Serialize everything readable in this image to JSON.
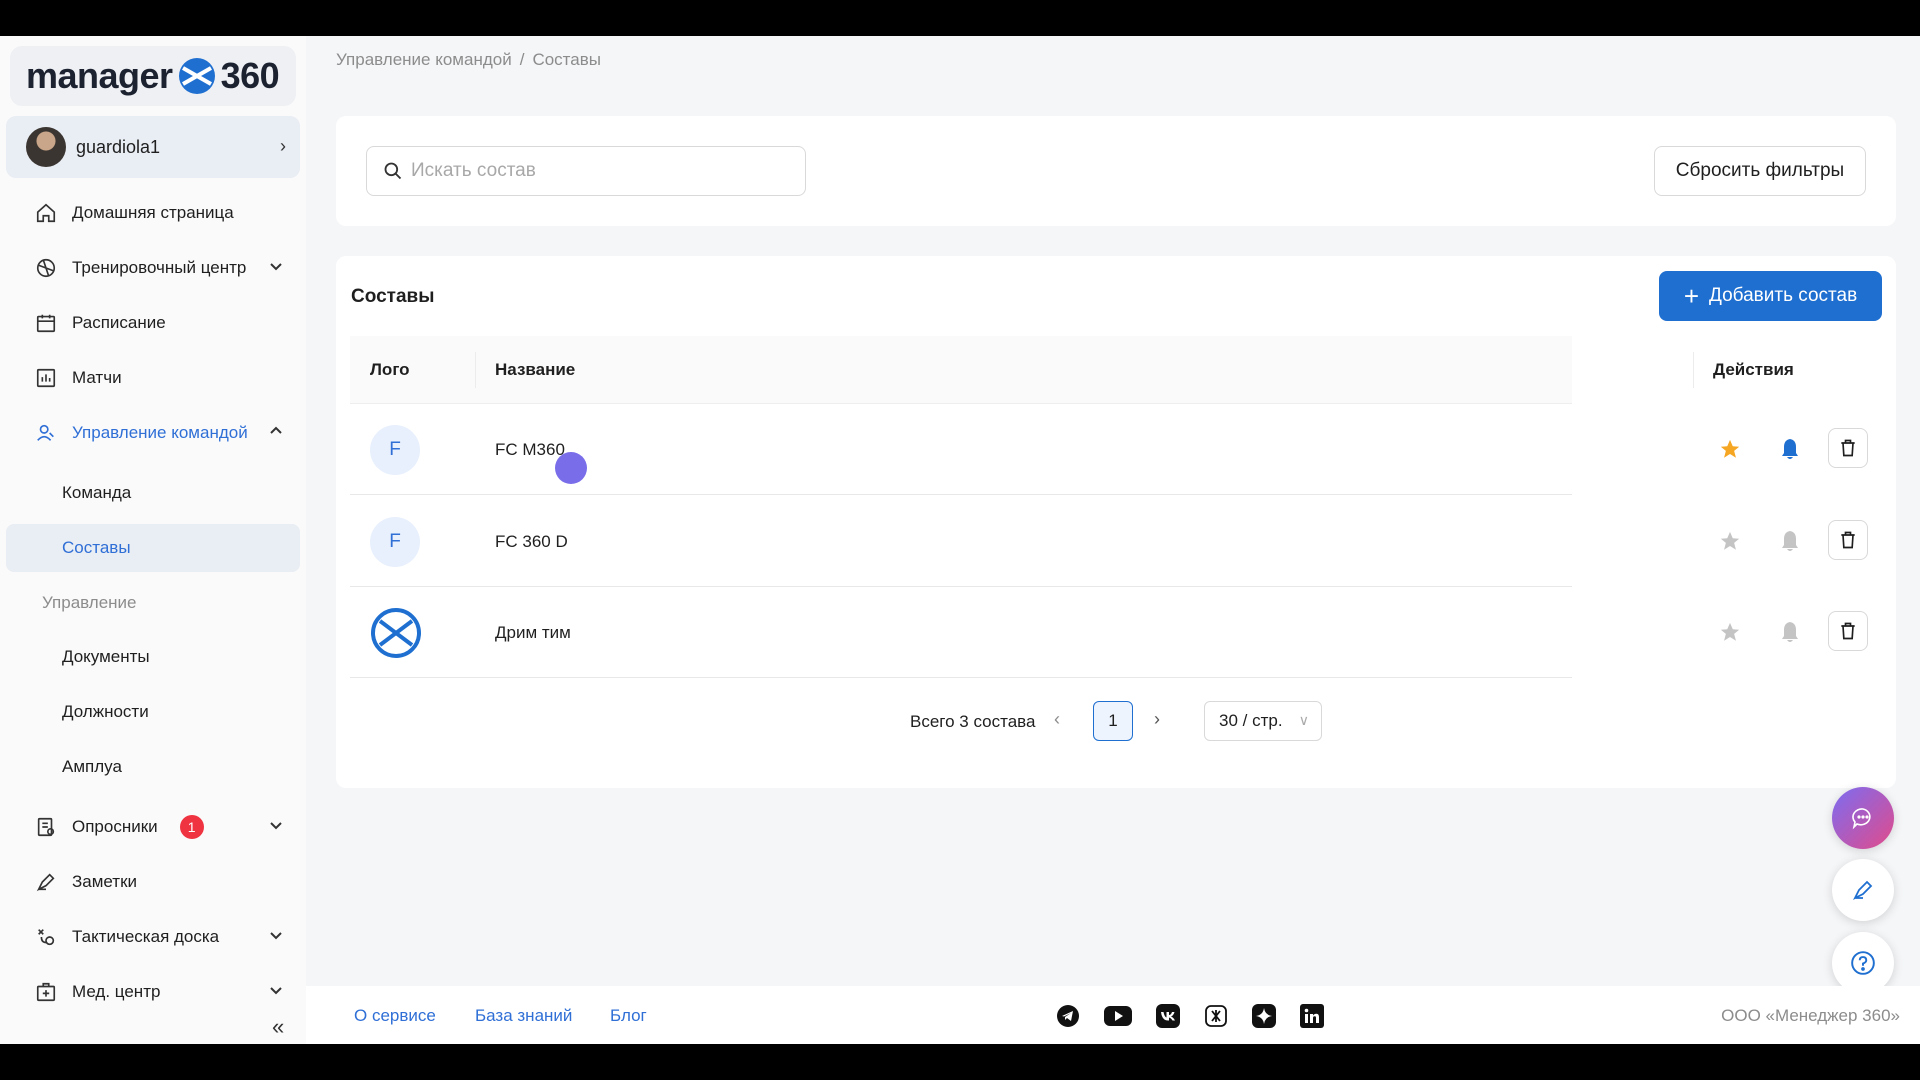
{
  "brand": {
    "name_left": "manager",
    "name_right": "360"
  },
  "user": {
    "name": "guardiola1"
  },
  "nav": {
    "home": "Домашняя страница",
    "training": "Тренировочный центр",
    "schedule": "Расписание",
    "matches": "Матчи",
    "team_mgmt": "Управление командой",
    "team": "Команда",
    "rosters": "Составы",
    "group_mgmt": "Управление",
    "documents": "Документы",
    "positions": "Должности",
    "roles": "Амплуа",
    "surveys": "Опросники",
    "surveys_badge": "1",
    "notes": "Заметки",
    "tactics": "Тактическая доска",
    "medical": "Мед. центр"
  },
  "breadcrumb": {
    "parent": "Управление командой",
    "sep": "/",
    "current": "Составы"
  },
  "search": {
    "placeholder": "Искать состав",
    "value": ""
  },
  "reset_filters": "Сбросить фильтры",
  "rosters_card": {
    "title": "Составы",
    "add_button": "Добавить состав"
  },
  "table": {
    "columns": {
      "logo": "Лого",
      "name": "Название",
      "actions": "Действия"
    },
    "rows": [
      {
        "logo_letter": "F",
        "name": "FC M360",
        "favorite": true,
        "notifications": true
      },
      {
        "logo_letter": "F",
        "name": "FC 360 D",
        "favorite": false,
        "notifications": false
      },
      {
        "logo_letter": "",
        "name": "Дрим тим",
        "favorite": false,
        "notifications": false
      }
    ]
  },
  "pagination": {
    "total": "Всего 3 состава",
    "page": "1",
    "page_size": "30 / стр."
  },
  "footer": {
    "about": "О сервисе",
    "knowledge": "База знаний",
    "blog": "Блог",
    "company": "ООО «Менеджер 360»"
  },
  "colors": {
    "accent": "#1f6fd1",
    "star": "#f5a623",
    "badge": "#ef3340",
    "muted": "#c4c4c4"
  }
}
